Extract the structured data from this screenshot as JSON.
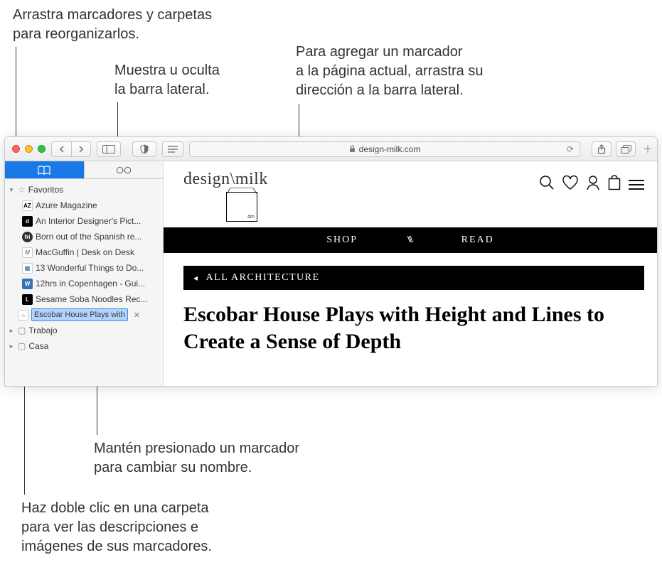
{
  "callouts": {
    "drag": "Arrastra marcadores y carpetas\npara reorganizarlos.",
    "toggle": "Muestra u oculta\nla barra lateral.",
    "add": "Para agregar un marcador\na la página actual, arrastra su\ndirección a la barra lateral.",
    "rename": "Mantén presionado un marcador\npara cambiar su nombre.",
    "double": "Haz doble clic en una carpeta\npara ver las descripciones e\nimágenes de sus marcadores."
  },
  "toolbar": {
    "address": "design-milk.com"
  },
  "sidebar": {
    "favorites_label": "Favoritos",
    "bookmarks": [
      {
        "label": "Azure Magazine",
        "icon_bg": "#ffffff",
        "icon_fg": "#000",
        "icon_txt": "AZ"
      },
      {
        "label": "An Interior Designer's Pict...",
        "icon_bg": "#000000",
        "icon_fg": "#fff",
        "icon_txt": "d"
      },
      {
        "label": "Born out of the Spanish re...",
        "icon_bg": "#2f2f2f",
        "icon_fg": "#fff",
        "icon_txt": "fri"
      },
      {
        "label": "MacGuffin | Desk on Desk",
        "icon_bg": "#ffffff",
        "icon_fg": "#777",
        "icon_txt": "M"
      },
      {
        "label": "13 Wonderful Things to Do...",
        "icon_bg": "#ffffff",
        "icon_fg": "#4a87c7",
        "icon_txt": "▦"
      },
      {
        "label": "12hrs in Copenhagen - Gui...",
        "icon_bg": "#3673b5",
        "icon_fg": "#fff",
        "icon_txt": "W"
      },
      {
        "label": "Sesame Soba Noodles Rec...",
        "icon_bg": "#000000",
        "icon_fg": "#fff",
        "icon_txt": "L"
      }
    ],
    "editing_label": "Escobar House Plays with",
    "folders": [
      "Trabajo",
      "Casa"
    ]
  },
  "page": {
    "logo": "design\\milk",
    "logo_dm": "dm",
    "nav": {
      "shop": "SHOP",
      "read": "READ"
    },
    "breadcrumb": "ALL ARCHITECTURE",
    "title": "Escobar House Plays with Height and Lines to Create a Sense of Depth"
  }
}
